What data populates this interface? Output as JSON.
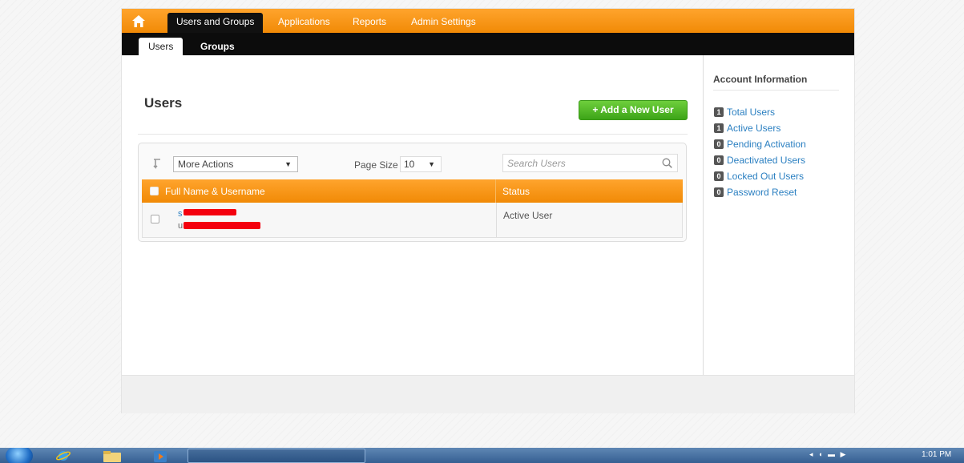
{
  "topnav": {
    "home_icon": "home-icon",
    "tabs": [
      {
        "label": "Users and Groups",
        "active": true
      },
      {
        "label": "Applications",
        "active": false
      },
      {
        "label": "Reports",
        "active": false
      },
      {
        "label": "Admin Settings",
        "active": false
      }
    ]
  },
  "subnav": {
    "tabs": [
      {
        "label": "Users",
        "active": true
      },
      {
        "label": "Groups",
        "active": false
      }
    ]
  },
  "main": {
    "title": "Users",
    "add_button": "+ Add a New User",
    "toolbar": {
      "more_actions": "More Actions",
      "page_size_label": "Page Size",
      "page_size_value": "10",
      "search_placeholder": "Search Users"
    },
    "table": {
      "columns": [
        "Full Name & Username",
        "Status"
      ],
      "rows": [
        {
          "name_visible": "s",
          "username_visible": "u",
          "status": "Active User"
        }
      ]
    }
  },
  "sidebar": {
    "title": "Account Information",
    "items": [
      {
        "count": "1",
        "label": "Total Users"
      },
      {
        "count": "1",
        "label": "Active Users"
      },
      {
        "count": "0",
        "label": "Pending Activation"
      },
      {
        "count": "0",
        "label": "Deactivated Users"
      },
      {
        "count": "0",
        "label": "Locked Out Users"
      },
      {
        "count": "0",
        "label": "Password Reset"
      }
    ]
  },
  "taskbar": {
    "clock": "1:01 PM"
  },
  "colors": {
    "accent_orange": "#f7941d",
    "nav_black": "#0c0c0c",
    "add_button_green": "#4db321",
    "link_blue": "#2a7fc1",
    "redaction_red": "#f4000e"
  }
}
